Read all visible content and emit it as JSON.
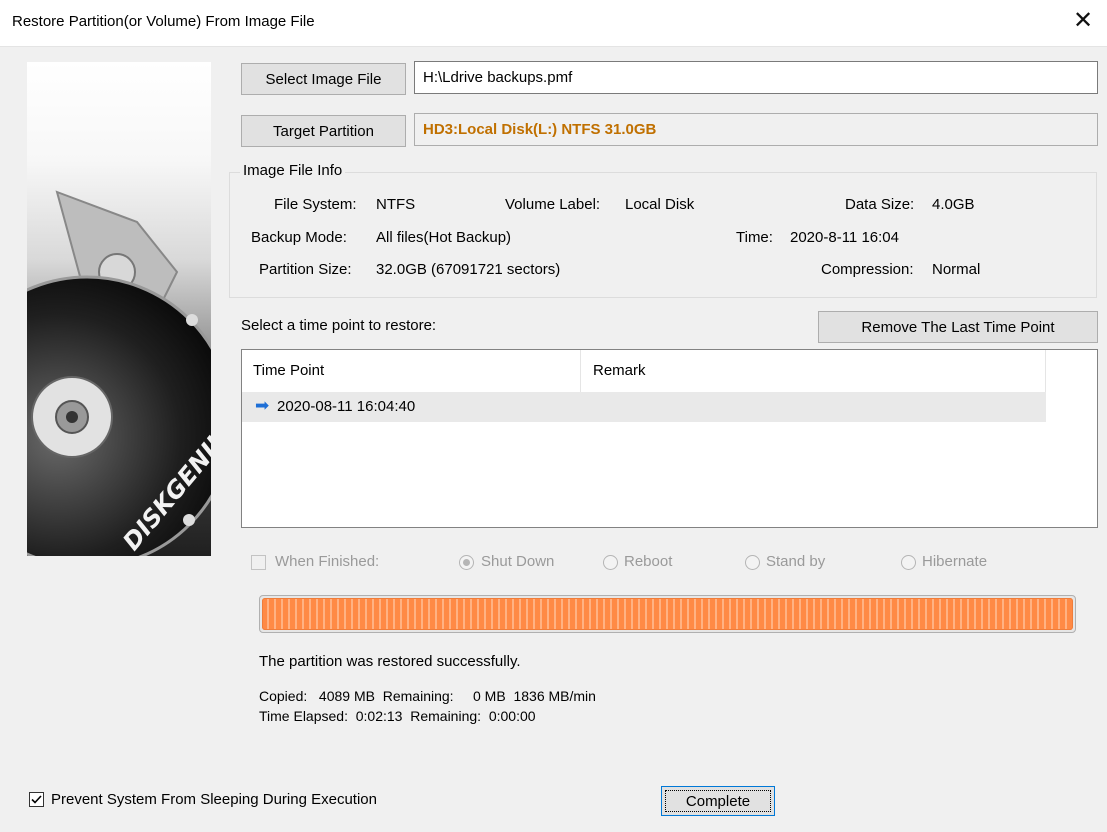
{
  "window": {
    "title": "Restore Partition(or Volume) From Image File"
  },
  "image_file": {
    "select_button": "Select Image File",
    "path": "H:\\Ldrive backups.pmf",
    "target_button": "Target Partition",
    "target_value": "HD3:Local Disk(L:) NTFS 31.0GB"
  },
  "image_info": {
    "group_title": "Image File Info",
    "file_system_label": "File System:",
    "file_system_value": "NTFS",
    "volume_label_label": "Volume Label:",
    "volume_label_value": "Local Disk",
    "data_size_label": "Data Size:",
    "data_size_value": "4.0GB",
    "backup_mode_label": "Backup Mode:",
    "backup_mode_value": "All files(Hot Backup)",
    "time_label": "Time:",
    "time_value": "2020-8-11 16:04",
    "partition_size_label": "Partition Size:",
    "partition_size_value": "32.0GB  (67091721 sectors)",
    "compression_label": "Compression:",
    "compression_value": "Normal"
  },
  "time_points": {
    "prompt": "Select a time point to restore:",
    "remove_button": "Remove The Last Time Point",
    "columns": [
      "Time Point",
      "Remark"
    ],
    "rows": [
      {
        "time": "2020-08-11 16:04:40",
        "remark": ""
      }
    ]
  },
  "when_finished": {
    "label": "When Finished:",
    "checked": false,
    "options": [
      "Shut Down",
      "Reboot",
      "Stand by",
      "Hibernate"
    ],
    "selected": "Shut Down"
  },
  "progress": {
    "percent": 100,
    "status": "The partition was restored successfully.",
    "line1": "Copied:   4089 MB  Remaining:     0 MB  1836 MB/min",
    "line2": "Time Elapsed:  0:02:13  Remaining:  0:00:00"
  },
  "footer": {
    "prevent_sleep_label": "Prevent System From Sleeping During Execution",
    "prevent_sleep_checked": true,
    "complete_button": "Complete"
  },
  "branding": {
    "logo_text": "DISKGENIUS"
  },
  "colors": {
    "target_text": "#c07000",
    "progress": "#ff8a45",
    "arrow": "#1e6fd6"
  }
}
